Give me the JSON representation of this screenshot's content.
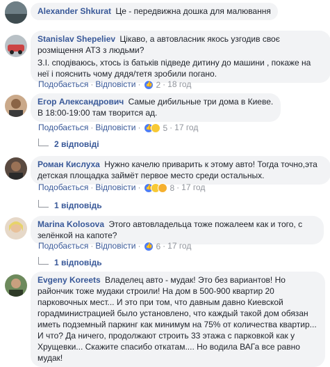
{
  "action_labels": {
    "like": "Подобається",
    "reply": "Відповісти",
    "sep": "·"
  },
  "comments": [
    {
      "author": "Alexander Shkurat",
      "text": "Це - передвижна дошка для малювання"
    },
    {
      "author": "Stanislav Shepeliev",
      "text": "Цікаво, а автовласник якось узгодив своє розміщення АТЗ з людьми?",
      "text2": "З.І. сподіваюсь, хтось із батьків підведе дитину до машини , покаже на неї і пояснить чому дядя/тетя зробили погано.",
      "count": "2",
      "time": "18 год"
    },
    {
      "author": "Егор Александрович",
      "text": "Самые дибильные три дома в Киеве. В 18:00-19:00 там творится ад.",
      "count": "5",
      "time": "17 год",
      "replies": "2 відповіді"
    },
    {
      "author": "Роман Кислуха",
      "text": "Нужно качелю приварить к этому авто! Тогда точно,эта детская площадка займёт первое место среди остальных.",
      "count": "8",
      "time": "17 год",
      "replies": "1 відповідь"
    },
    {
      "author": "Marina Kolosova",
      "text": "Этого автовладельца тоже пожалеем как и того, с зелёнкой на капоте?",
      "count": "6",
      "time": "17 год",
      "replies": "1 відповідь"
    },
    {
      "author": "Evgeny Koreets",
      "text": "Владелец авто - мудак! Это без вариантов! Но райончик тоже мудаки строили! На дом в 500-900 квартир 20 парковочных мест... И это при том, что давным давно Киевской горадминистрацией было установлено, что каждый такой дом обязан иметь подземный паркинг как минимум на 75% от количества квартир... И что? Да ничего, продолжают строить 33 этажа с парковкой как у Хрущевки... Скажите спасибо откатам.... Но водила ВАГа все равно мудак!"
    }
  ],
  "colors": {
    "link": "#385898",
    "bubble": "#f2f3f5",
    "meta": "#90949c"
  }
}
